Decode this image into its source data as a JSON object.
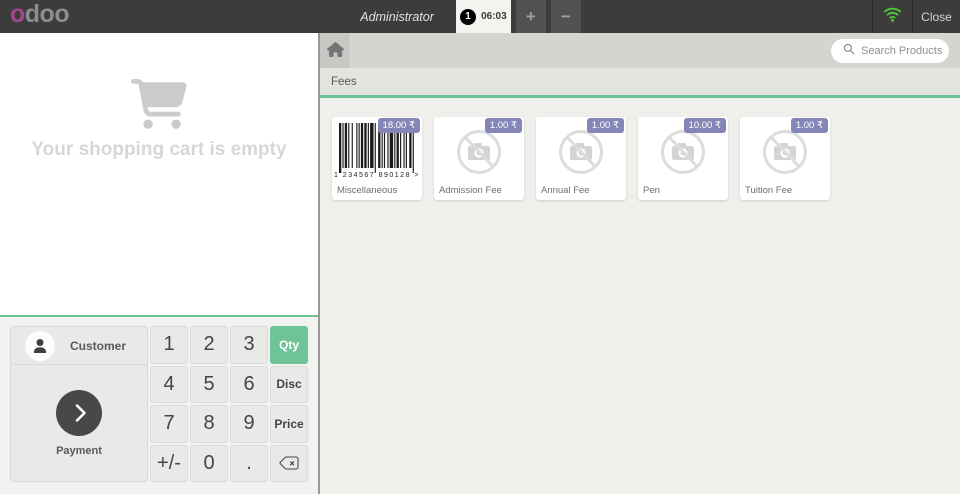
{
  "topbar": {
    "logo_first": "o",
    "logo_rest": "doo",
    "user": "Administrator",
    "order_tab": {
      "number": "1",
      "time": "06:03"
    },
    "add_label": "+",
    "remove_label": "−",
    "close_label": "Close",
    "icons": [
      "wifi-icon"
    ],
    "colors": {
      "bar": "#3c3c3c",
      "logo_accent": "#a2478f",
      "wifi": "#4fc637"
    }
  },
  "cart": {
    "empty_message": "Your shopping cart is empty"
  },
  "actionpad": {
    "customer_label": "Customer",
    "payment_label": "Payment",
    "icons": [
      "user-icon",
      "chevron-right-icon"
    ]
  },
  "numpad": {
    "keys": [
      {
        "label": "1",
        "type": "digit"
      },
      {
        "label": "2",
        "type": "digit"
      },
      {
        "label": "3",
        "type": "digit"
      },
      {
        "label": "Qty",
        "type": "mode",
        "active": true
      },
      {
        "label": "4",
        "type": "digit"
      },
      {
        "label": "5",
        "type": "digit"
      },
      {
        "label": "6",
        "type": "digit"
      },
      {
        "label": "Disc",
        "type": "mode"
      },
      {
        "label": "7",
        "type": "digit"
      },
      {
        "label": "8",
        "type": "digit"
      },
      {
        "label": "9",
        "type": "digit"
      },
      {
        "label": "Price",
        "type": "mode"
      },
      {
        "label": "+/-",
        "type": "digit"
      },
      {
        "label": "0",
        "type": "digit"
      },
      {
        "label": ".",
        "type": "digit"
      },
      {
        "label": "",
        "type": "backspace",
        "icon": "backspace-icon"
      }
    ],
    "colors": {
      "active_key": "#6ec496"
    }
  },
  "products_screen": {
    "search_placeholder": "Search Products",
    "category": "Fees",
    "currency": "₹",
    "accent_color": "#6ec496",
    "price_tag_color": "#8486b7",
    "products": [
      {
        "name": "Miscellaneous",
        "price": "18.00 ₹",
        "image": "barcode",
        "barcode_text": "1 234567 890128 >"
      },
      {
        "name": "Admission Fee",
        "price": "1.00 ₹",
        "image": "placeholder"
      },
      {
        "name": "Annual Fee",
        "price": "1.00 ₹",
        "image": "placeholder"
      },
      {
        "name": "Pen",
        "price": "10.00 ₹",
        "image": "placeholder"
      },
      {
        "name": "Tuition Fee",
        "price": "1.00 ₹",
        "image": "placeholder"
      }
    ]
  }
}
